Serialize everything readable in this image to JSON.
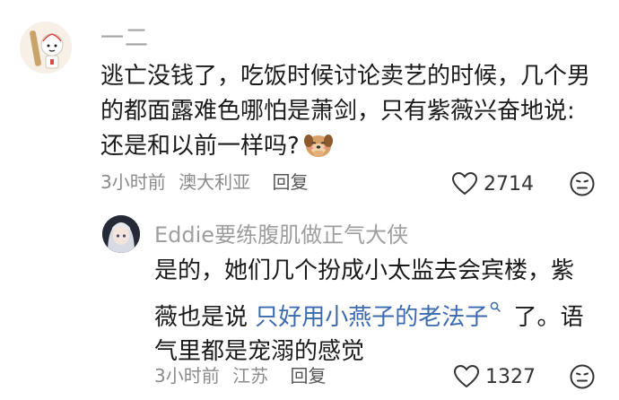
{
  "comments": [
    {
      "username": "一二",
      "text_before_emoji": "逃亡没钱了，吃饭时候讨论卖艺的时候，几个男的都面露难色哪怕是萧剑，只有紫薇兴奋地说: 还是和以前一样吗?",
      "emoji_icon": "shy-dog-emoji",
      "time": "3小时前",
      "location": "澳大利亚",
      "reply_label": "回复",
      "like_count": "2714"
    },
    {
      "username": "Eddie要练腹肌做正气大侠",
      "text_before_link": "是的，她们几个扮成小太监去会宾楼，紫薇也是说 ",
      "link_text": "只好用小燕子的老法子",
      "text_after_link": " 了。语气里都是宠溺的感觉",
      "time": "3小时前",
      "location": "江苏",
      "reply_label": "回复",
      "like_count": "1327"
    }
  ],
  "colors": {
    "link": "#3c6ab0",
    "meta": "#8a8a8a",
    "username": "#a3a3a3"
  }
}
